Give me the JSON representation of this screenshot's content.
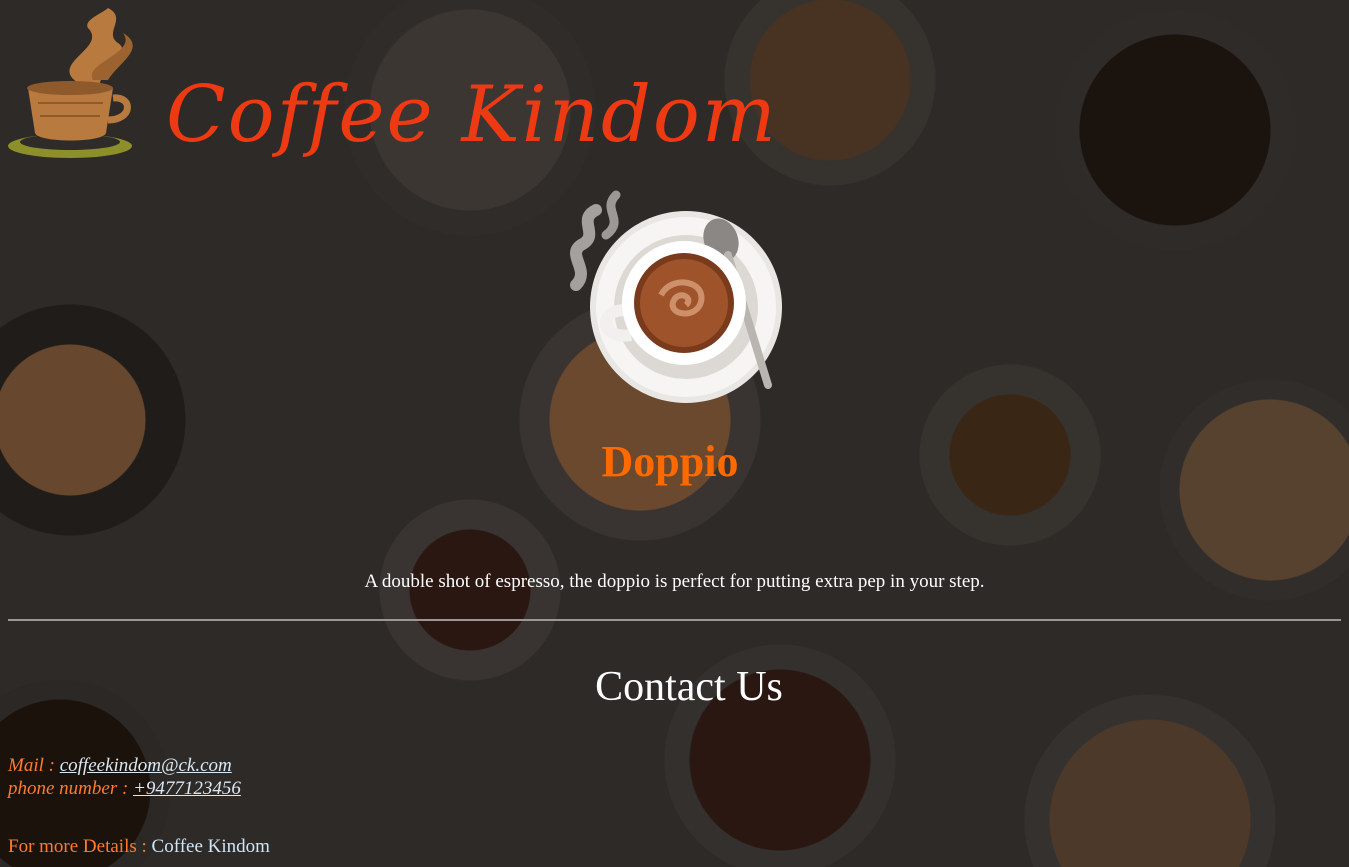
{
  "brand": {
    "name": "Coffee Kindom"
  },
  "product": {
    "name": "Doppio",
    "description": "A double shot of espresso, the doppio is perfect for putting extra pep in your step."
  },
  "contact": {
    "title": "Contact Us",
    "mail_label": "Mail : ",
    "mail_value": "coffeekindom@ck.com ",
    "phone_label": "phone number : ",
    "phone_value": "+9477123456"
  },
  "footer": {
    "details_label": "For more Details : ",
    "details_link": "Coffee Kindom"
  },
  "colors": {
    "brand": "#ee3a12",
    "product_name": "#ff6a00",
    "label": "#ff7b2e",
    "link": "#dbe9f5"
  },
  "icons": {
    "logo": "coffee-cup-logo-icon",
    "product": "espresso-cup-image"
  }
}
